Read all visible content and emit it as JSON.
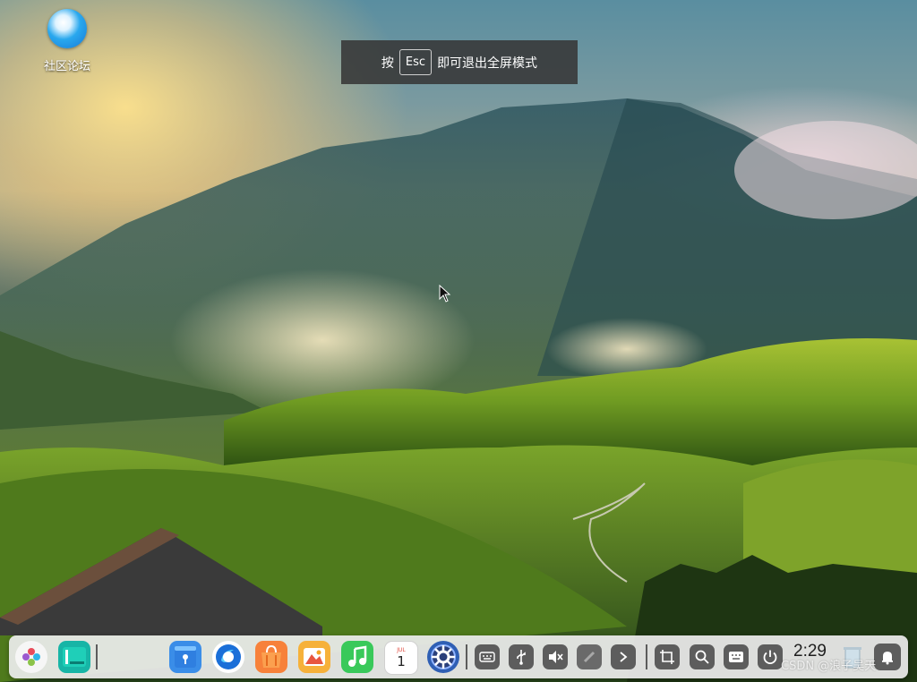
{
  "desktop": {
    "icons": [
      {
        "label": "社区论坛",
        "icon": "deepin-forum-icon"
      }
    ]
  },
  "fullscreen_notice": {
    "prefix": "按",
    "key": "Esc",
    "suffix": "即可退出全屏模式"
  },
  "dock": {
    "left_apps": [
      {
        "icon": "launcher-icon"
      },
      {
        "icon": "multitasking-view-icon"
      }
    ],
    "apps": [
      {
        "icon": "file-manager-icon"
      },
      {
        "icon": "browser-icon"
      },
      {
        "icon": "app-store-icon"
      },
      {
        "icon": "image-viewer-icon"
      },
      {
        "icon": "music-icon"
      },
      {
        "icon": "calendar-icon",
        "month": "JUL",
        "day": "1"
      },
      {
        "icon": "control-center-icon"
      }
    ],
    "tray": [
      {
        "icon": "keyboard-icon"
      },
      {
        "icon": "usb-icon"
      },
      {
        "icon": "volume-muted-icon"
      },
      {
        "icon": "network-disconnected-icon"
      },
      {
        "icon": "tray-expand-icon"
      }
    ],
    "right": [
      {
        "icon": "screenshot-icon"
      },
      {
        "icon": "search-icon"
      },
      {
        "icon": "onscreen-keyboard-icon"
      },
      {
        "icon": "power-icon"
      },
      {
        "icon": "trash-icon"
      },
      {
        "icon": "notification-icon"
      }
    ],
    "clock": "2:29"
  },
  "watermark": "CSDN @浪子吴天",
  "colors": {
    "tray_bg": "#5d5d5d",
    "dock_bg": "#ececec",
    "banner_bg": "#373737"
  }
}
